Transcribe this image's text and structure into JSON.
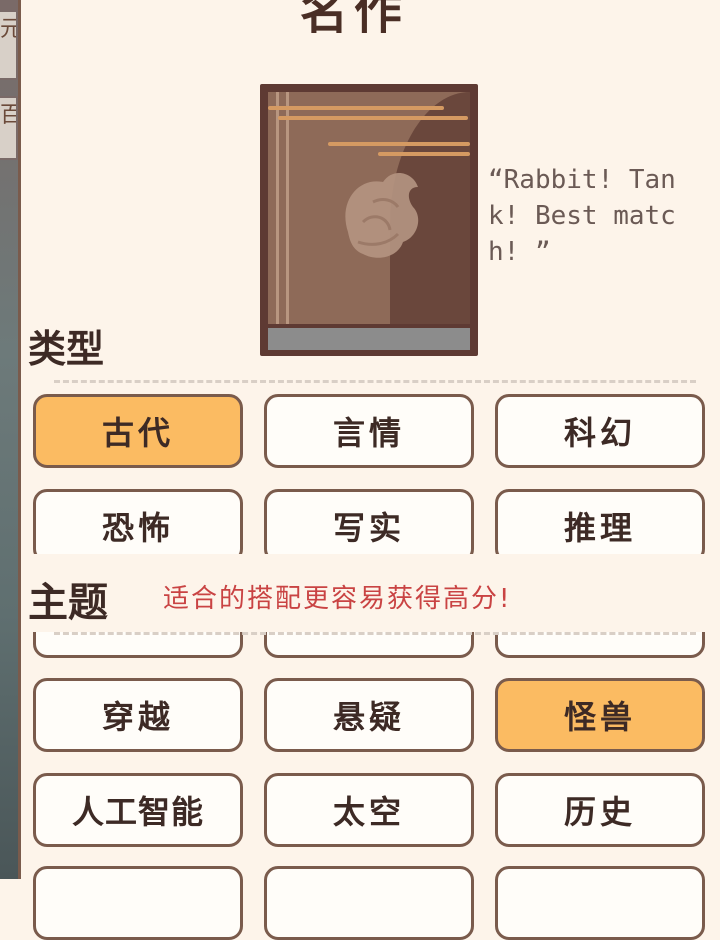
{
  "header": {
    "title_fragment": "名作"
  },
  "side_tabs": [
    "元",
    "百"
  ],
  "book": {
    "quote": "“Rabbit! Tank! Best match! ”",
    "colors": {
      "cover": "#8e6a58",
      "frame": "#5e3a33",
      "accent": "#d59a62"
    }
  },
  "genre": {
    "label": "类型",
    "options": [
      {
        "label": "古代",
        "selected": true
      },
      {
        "label": "言情",
        "selected": false
      },
      {
        "label": "科幻",
        "selected": false
      },
      {
        "label": "恐怖",
        "selected": false
      },
      {
        "label": "写实",
        "selected": false
      },
      {
        "label": "推理",
        "selected": false
      }
    ]
  },
  "theme": {
    "label": "主题",
    "hint": "适合的搭配更容易获得高分!",
    "options": [
      {
        "label": "穿越",
        "selected": false
      },
      {
        "label": "悬疑",
        "selected": false
      },
      {
        "label": "怪兽",
        "selected": true
      },
      {
        "label": "人工智能",
        "selected": false
      },
      {
        "label": "太空",
        "selected": false
      },
      {
        "label": "历史",
        "selected": false
      }
    ]
  },
  "colors": {
    "selected": "#fbbb62",
    "border": "#7a5b4c",
    "hint": "#c94343"
  }
}
